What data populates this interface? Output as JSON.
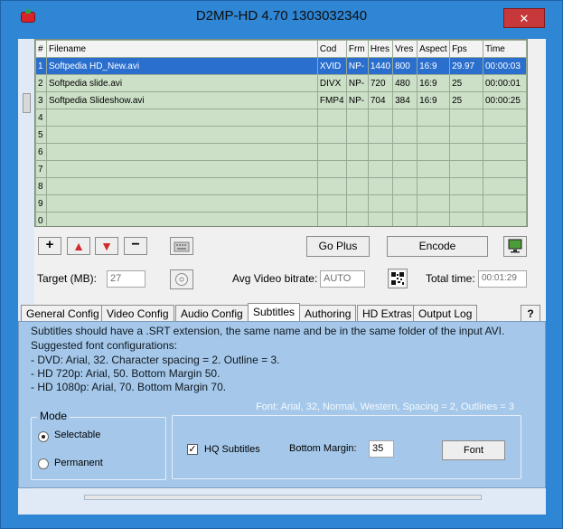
{
  "window": {
    "title": "D2MP-HD 4.70 1303032340",
    "minimize": "—",
    "maximize": "▢",
    "close": "✕"
  },
  "table": {
    "headers": [
      "#",
      "Filename",
      "Cod",
      "Frm",
      "Hres",
      "Vres",
      "Aspect",
      "Fps",
      "Time"
    ],
    "rows": [
      {
        "num": "1",
        "filename": "Softpedia HD_New.avi",
        "cod": "XVID",
        "frm": "NP-",
        "hres": "1440",
        "vres": "800",
        "aspect": "16:9",
        "fps": "29.97",
        "time": "00:00:03"
      },
      {
        "num": "2",
        "filename": "Softpedia slide.avi",
        "cod": "DIVX",
        "frm": "NP-",
        "hres": "720",
        "vres": "480",
        "aspect": "16:9",
        "fps": "25",
        "time": "00:00:01"
      },
      {
        "num": "3",
        "filename": "Softpedia Slideshow.avi",
        "cod": "FMP4",
        "frm": "NP-",
        "hres": "704",
        "vres": "384",
        "aspect": "16:9",
        "fps": "25",
        "time": "00:00:25"
      },
      {
        "num": "4"
      },
      {
        "num": "5"
      },
      {
        "num": "6"
      },
      {
        "num": "7"
      },
      {
        "num": "8"
      },
      {
        "num": "9"
      },
      {
        "num": "0"
      }
    ]
  },
  "toolbar": {
    "add": "+",
    "up": "▲",
    "down": "▼",
    "remove": "−",
    "go_plus": "Go Plus",
    "encode": "Encode"
  },
  "settings": {
    "target_label": "Target (MB):",
    "target_value": "27",
    "bitrate_label": "Avg Video bitrate:",
    "bitrate_value": "AUTO",
    "total_label": "Total time:",
    "total_value": "00:01:29"
  },
  "tabs": [
    {
      "label": "General Config"
    },
    {
      "label": "Video Config"
    },
    {
      "label": "Audio Config"
    },
    {
      "label": "Subtitles"
    },
    {
      "label": "Authoring"
    },
    {
      "label": "HD Extras"
    },
    {
      "label": "Output Log"
    },
    {
      "label": "?"
    }
  ],
  "subtitles": {
    "line1": "Subtitles should have a .SRT extension, the same name and be in the same folder of the input AVI.",
    "line2": "Suggested font configurations:",
    "line3": "- DVD: Arial, 32. Character spacing = 2. Outline = 3.",
    "line4": "- HD 720p: Arial, 50. Bottom Margin 50.",
    "line5": "- HD 1080p: Arial, 70. Bottom Margin 70.",
    "font_info": "Font: Arial, 32, Normal, Western, Spacing = 2, Outlines = 3",
    "mode_title": "Mode",
    "selectable": "Selectable",
    "permanent": "Permanent",
    "hq_label": "HQ Subtitles",
    "bottom_margin_label": "Bottom Margin:",
    "bottom_margin_value": "35",
    "font_button": "Font"
  }
}
